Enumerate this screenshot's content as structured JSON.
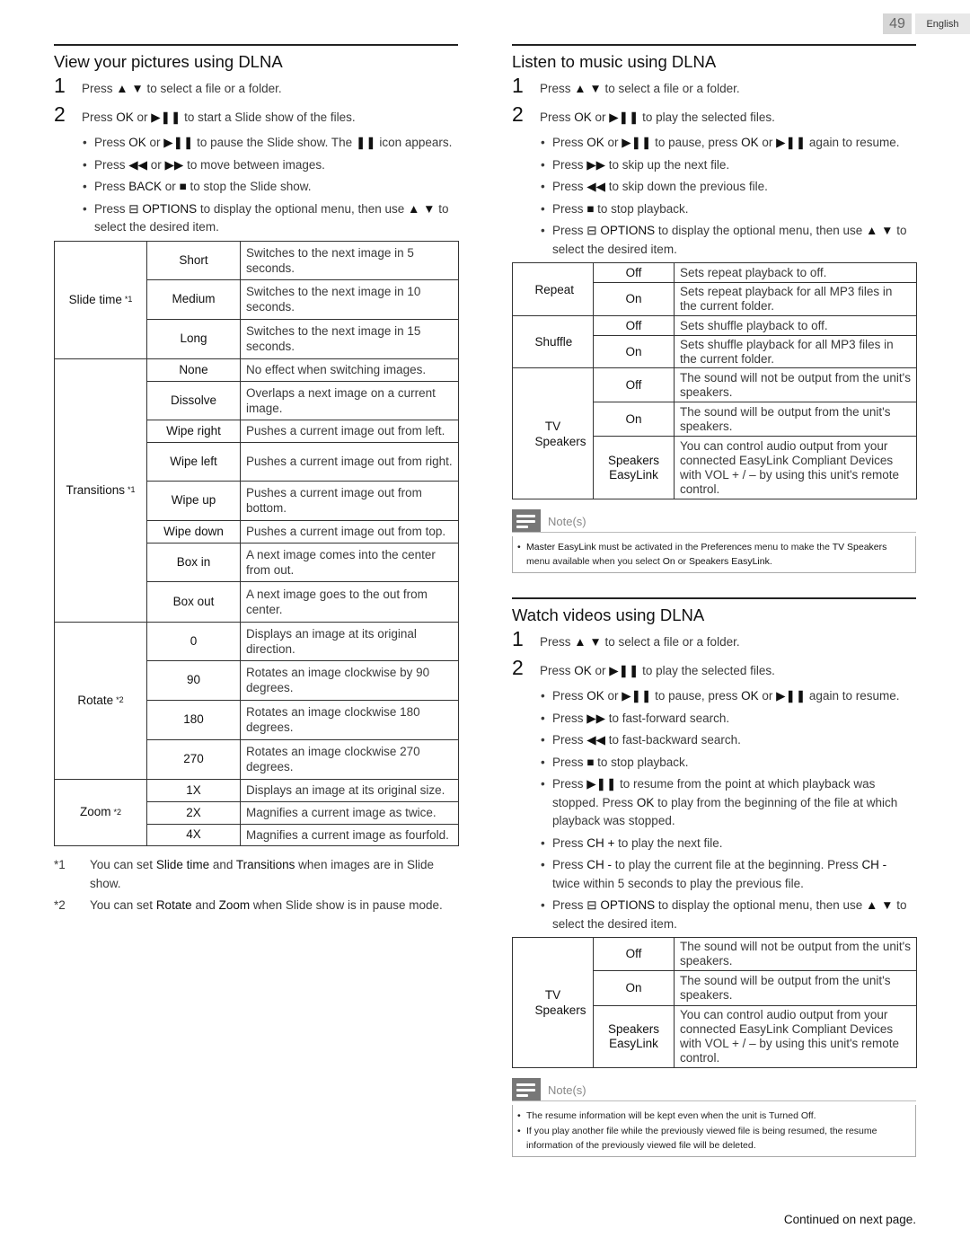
{
  "header": {
    "page_number": "49",
    "language": "English"
  },
  "left": {
    "title": "View your pictures using DLNA",
    "steps": [
      {
        "num": "1",
        "segs": [
          "Press ",
          {
            "b": "▲ ▼"
          },
          " to select a file or a folder."
        ]
      },
      {
        "num": "2",
        "segs": [
          "Press ",
          {
            "b": "OK"
          },
          " or ",
          {
            "b": "▶❚❚"
          },
          " to start a Slide show of the files."
        ]
      }
    ],
    "bullets": [
      [
        "Press ",
        {
          "b": "OK"
        },
        " or ",
        {
          "b": "▶❚❚"
        },
        " to pause the Slide show. The ",
        {
          "b": "❚❚"
        },
        " icon appears."
      ],
      [
        "Press ",
        {
          "b": "◀◀"
        },
        " or ",
        {
          "b": "▶▶"
        },
        " to move between images."
      ],
      [
        "Press ",
        {
          "b": "BACK"
        },
        " or ",
        {
          "b": "■"
        },
        " to stop the Slide show."
      ],
      [
        "Press ",
        {
          "b": "⊟ OPTIONS"
        },
        " to display the optional menu, then use ",
        {
          "b": "▲ ▼"
        },
        " to select the desired item."
      ]
    ],
    "table": [
      {
        "label": "Slide time",
        "note": "*1",
        "rows": [
          [
            "Short",
            "Switches to the next image in 5 seconds."
          ],
          [
            "Medium",
            "Switches to the next image in 10 seconds."
          ],
          [
            "Long",
            "Switches to the next image in 15 seconds."
          ]
        ]
      },
      {
        "label": "Transitions",
        "note": "*1",
        "rows": [
          [
            "None",
            "No effect when switching images."
          ],
          [
            "Dissolve",
            "Overlaps a next image on a current image."
          ],
          [
            "Wipe right",
            "Pushes a current image out from left."
          ],
          [
            "Wipe left",
            "Pushes a current image out from right."
          ],
          [
            "Wipe up",
            "Pushes a current image out from bottom."
          ],
          [
            "Wipe down",
            "Pushes a current image out from top."
          ],
          [
            "Box in",
            "A next image comes into the center from out."
          ],
          [
            "Box out",
            "A next image goes to the out from center."
          ]
        ]
      },
      {
        "label": "Rotate",
        "note": "*2",
        "rows": [
          [
            "0",
            "Displays an image at its original direction."
          ],
          [
            "90",
            "Rotates an image clockwise by 90 degrees."
          ],
          [
            "180",
            "Rotates an image clockwise 180 degrees."
          ],
          [
            "270",
            "Rotates an image clockwise 270 degrees."
          ]
        ]
      },
      {
        "label": "Zoom",
        "note": "*2",
        "rows": [
          [
            "1X",
            "Displays an image at its original size."
          ],
          [
            "2X",
            "Magnifies a current image as twice."
          ],
          [
            "4X",
            "Magnifies a current image as fourfold."
          ]
        ]
      }
    ],
    "footnotes": [
      {
        "mark": "*1",
        "segs": [
          "You can set ",
          {
            "b": "Slide time"
          },
          " and ",
          {
            "b": "Transitions"
          },
          " when images are in Slide show."
        ]
      },
      {
        "mark": "*2",
        "segs": [
          "You can set ",
          {
            "b": "Rotate"
          },
          " and ",
          {
            "b": "Zoom"
          },
          " when Slide show is in pause mode."
        ]
      }
    ]
  },
  "music": {
    "title": "Listen to music using DLNA",
    "steps": [
      {
        "num": "1",
        "segs": [
          "Press ",
          {
            "b": "▲ ▼"
          },
          " to select a file or a folder."
        ]
      },
      {
        "num": "2",
        "segs": [
          "Press ",
          {
            "b": "OK"
          },
          " or ",
          {
            "b": "▶❚❚"
          },
          " to play the selected files."
        ]
      }
    ],
    "bullets": [
      [
        "Press ",
        {
          "b": "OK"
        },
        " or ",
        {
          "b": "▶❚❚"
        },
        " to pause, press ",
        {
          "b": "OK"
        },
        " or ",
        {
          "b": "▶❚❚"
        },
        " again to resume."
      ],
      [
        "Press ",
        {
          "b": "▶▶"
        },
        " to skip up the next file."
      ],
      [
        "Press ",
        {
          "b": "◀◀"
        },
        " to skip down the previous file."
      ],
      [
        "Press ",
        {
          "b": "■"
        },
        " to stop playback."
      ],
      [
        "Press ",
        {
          "b": "⊟ OPTIONS"
        },
        " to display the optional menu, then use ",
        {
          "b": "▲ ▼"
        },
        " to select the desired item."
      ]
    ],
    "table": [
      {
        "label": "Repeat",
        "rows": [
          [
            "Off",
            "Sets repeat playback to off."
          ],
          [
            "On",
            "Sets repeat playback for all MP3 files in the current folder."
          ]
        ]
      },
      {
        "label": "Shuffle",
        "rows": [
          [
            "Off",
            "Sets shuffle playback to off."
          ],
          [
            "On",
            "Sets shuffle playback for all MP3 files in the current folder."
          ]
        ]
      },
      {
        "label": "TV Speakers",
        "rows": [
          [
            "Off",
            "The sound will not be output from the unit's speakers."
          ],
          [
            "On",
            "The sound will be output from the unit's speakers."
          ],
          [
            "Speakers EasyLink",
            "You can control audio output from your connected EasyLink Compliant Devices with VOL + / – by using this unit's remote control."
          ]
        ]
      }
    ],
    "note_label": "Note(s)",
    "notes": [
      [
        {
          "b": "Master EasyLink"
        },
        " must be activated in the ",
        {
          "b": "Preferences"
        },
        " menu to make the ",
        {
          "b": "TV Speakers"
        },
        " menu available when you select ",
        {
          "b": "On"
        },
        " or ",
        {
          "b": "Speakers EasyLink"
        },
        "."
      ]
    ]
  },
  "video": {
    "title": "Watch videos using DLNA",
    "steps": [
      {
        "num": "1",
        "segs": [
          "Press ",
          {
            "b": "▲ ▼"
          },
          " to select a file or a folder."
        ]
      },
      {
        "num": "2",
        "segs": [
          "Press ",
          {
            "b": "OK"
          },
          " or ",
          {
            "b": "▶❚❚"
          },
          " to play the selected files."
        ]
      }
    ],
    "bullets": [
      [
        "Press ",
        {
          "b": "OK"
        },
        " or ",
        {
          "b": "▶❚❚"
        },
        " to pause, press ",
        {
          "b": "OK"
        },
        " or ",
        {
          "b": "▶❚❚"
        },
        " again to resume."
      ],
      [
        "Press ",
        {
          "b": "▶▶"
        },
        " to fast-forward search."
      ],
      [
        "Press ",
        {
          "b": "◀◀"
        },
        " to fast-backward search."
      ],
      [
        "Press ",
        {
          "b": "■"
        },
        " to stop playback."
      ],
      [
        "Press ",
        {
          "b": "▶❚❚"
        },
        " to resume from the point at which playback was stopped. Press ",
        {
          "b": "OK"
        },
        " to play from the beginning of the file at which playback was stopped."
      ],
      [
        "Press ",
        {
          "b": "CH +"
        },
        " to play the next file."
      ],
      [
        "Press ",
        {
          "b": "CH -"
        },
        " to play the current file at the beginning. Press ",
        {
          "b": "CH -"
        },
        " twice within 5 seconds to play the previous file."
      ],
      [
        "Press ",
        {
          "b": "⊟ OPTIONS"
        },
        " to display the optional menu, then use ",
        {
          "b": "▲ ▼"
        },
        " to select the desired item."
      ]
    ],
    "table": [
      {
        "label": "TV Speakers",
        "rows": [
          [
            "Off",
            "The sound will not be output from the unit's speakers."
          ],
          [
            "On",
            "The sound will be output from the unit's speakers."
          ],
          [
            "Speakers EasyLink",
            "You can control audio output from your connected EasyLink Compliant Devices with VOL + / – by using this unit's remote control."
          ]
        ]
      }
    ],
    "note_label": "Note(s)",
    "notes": [
      [
        "The resume information will be kept even when the unit is Turned Off."
      ],
      [
        "If you play another file while the previously viewed file is being resumed, the resume information of the previously viewed file will be deleted."
      ]
    ]
  },
  "footer": {
    "continued": "Continued on next page."
  }
}
